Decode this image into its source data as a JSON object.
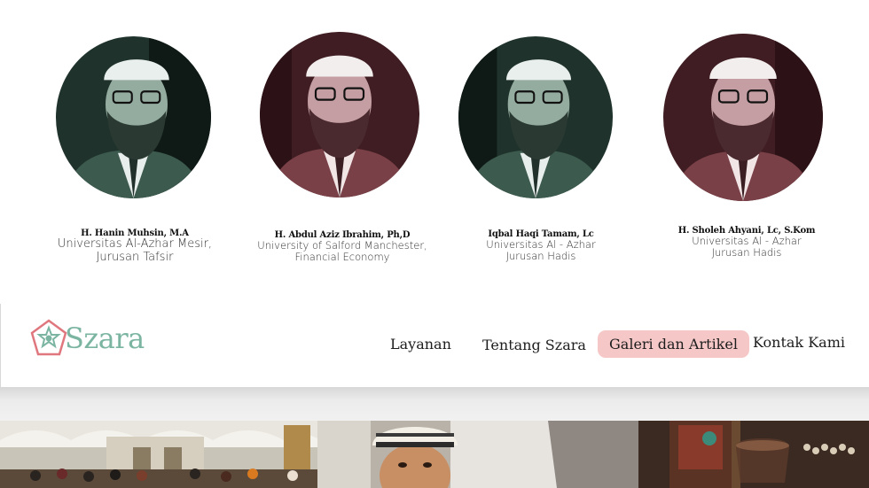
{
  "team": {
    "members": [
      {
        "name": "H. Hanin Muhsin, M.A",
        "line1": "Universitas Al-Azhar Mesir,",
        "line2": "Jurusan Tafsir",
        "tint": "#2f4a40"
      },
      {
        "name": "H. Abdul Aziz Ibrahim, Ph,D",
        "line1": "University of Salford Manchester,",
        "line2": "Financial Economy",
        "tint": "#5a2a30"
      },
      {
        "name": "Iqbal  Haqi Tamam, Lc",
        "line1": "Universitas Al - Azhar",
        "line2": "Jurusan Hadis",
        "tint": "#2f4a40"
      },
      {
        "name": "H. Sholeh Ahyani, Lc, S.Kom",
        "line1": "Universitas Al - Azhar",
        "line2": "Jurusan Hadis",
        "tint": "#5a2a30"
      }
    ]
  },
  "header": {
    "logo_text": "Szara",
    "nav": [
      {
        "label": "Layanan"
      },
      {
        "label": "Tentang Szara"
      },
      {
        "label": "Galeri dan Artikel",
        "active": true
      },
      {
        "label": "Kontak Kami"
      }
    ]
  },
  "colors": {
    "brand": "#7bb5a2",
    "brand_accent": "#e0777e",
    "active_nav_bg": "#f5c7c7"
  },
  "gallery": {
    "tiles": [
      {
        "icon": "mosque-crowd-photo"
      },
      {
        "icon": "child-reading-photo"
      },
      {
        "icon": "lantern-tea-photo"
      }
    ]
  }
}
